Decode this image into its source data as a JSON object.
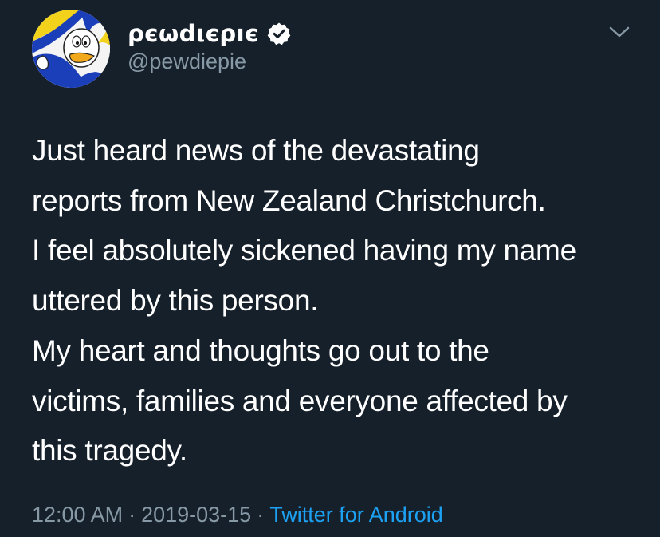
{
  "user": {
    "display_name": "ρєωdιєρıє",
    "handle": "@pewdiepie",
    "verified": true
  },
  "tweet": {
    "lines": [
      "Just heard news of the devastating",
      "reports from New Zealand Christchurch.",
      "I feel absolutely sickened having my name",
      "uttered by this person.",
      "My heart and thoughts go out to the",
      "victims, families and everyone affected by",
      "this tragedy."
    ],
    "time": "12:00 AM",
    "date": "2019-03-15",
    "separator": "·",
    "source": "Twitter for Android"
  },
  "icons": {
    "verified": "verified-badge-icon",
    "more": "chevron-down-icon",
    "avatar": "cartoon-duck-avatar"
  },
  "colors": {
    "background": "#15202b",
    "text": "#ffffff",
    "secondary": "#8899a6",
    "link": "#1da1f2"
  }
}
